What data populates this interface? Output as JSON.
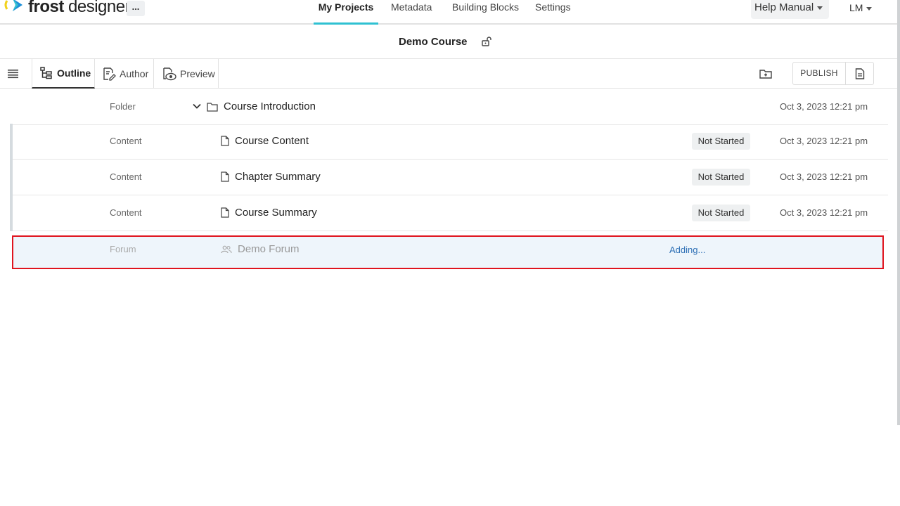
{
  "brand": {
    "name_bold": "frost",
    "name_rest": " designer"
  },
  "topnav": {
    "more_label": "...",
    "tabs": [
      {
        "label": "My Projects",
        "active": true
      },
      {
        "label": "Metadata",
        "active": false
      },
      {
        "label": "Building Blocks",
        "active": false
      },
      {
        "label": "Settings",
        "active": false
      }
    ],
    "help_label": "Help Manual",
    "user_initials": "LM"
  },
  "course": {
    "title": "Demo Course"
  },
  "toolbar": {
    "tabs": [
      {
        "label": "Outline",
        "active": true
      },
      {
        "label": "Author",
        "active": false
      },
      {
        "label": "Preview",
        "active": false
      }
    ],
    "publish_label": "PUBLISH"
  },
  "rows": [
    {
      "type": "Folder",
      "title": "Course Introduction",
      "status": "",
      "date": "Oct 3, 2023 12:21 pm"
    },
    {
      "type": "Content",
      "title": "Course Content",
      "status": "Not Started",
      "date": "Oct 3, 2023 12:21 pm"
    },
    {
      "type": "Content",
      "title": "Chapter Summary",
      "status": "Not Started",
      "date": "Oct 3, 2023 12:21 pm"
    },
    {
      "type": "Content",
      "title": "Course Summary",
      "status": "Not Started",
      "date": "Oct 3, 2023 12:21 pm"
    }
  ],
  "pending_row": {
    "type": "Forum",
    "title": "Demo Forum",
    "state": "Adding..."
  },
  "colors": {
    "accent": "#2fc1d2",
    "highlight_border": "#e0141e",
    "link": "#2d6fb5"
  },
  "icons": [
    "logo-mark",
    "lock-icon",
    "menu-icon",
    "outline-icon",
    "author-icon",
    "preview-icon",
    "folder-add-icon",
    "document-icon",
    "chevron-down-icon",
    "folder-icon",
    "page-icon",
    "users-icon"
  ]
}
